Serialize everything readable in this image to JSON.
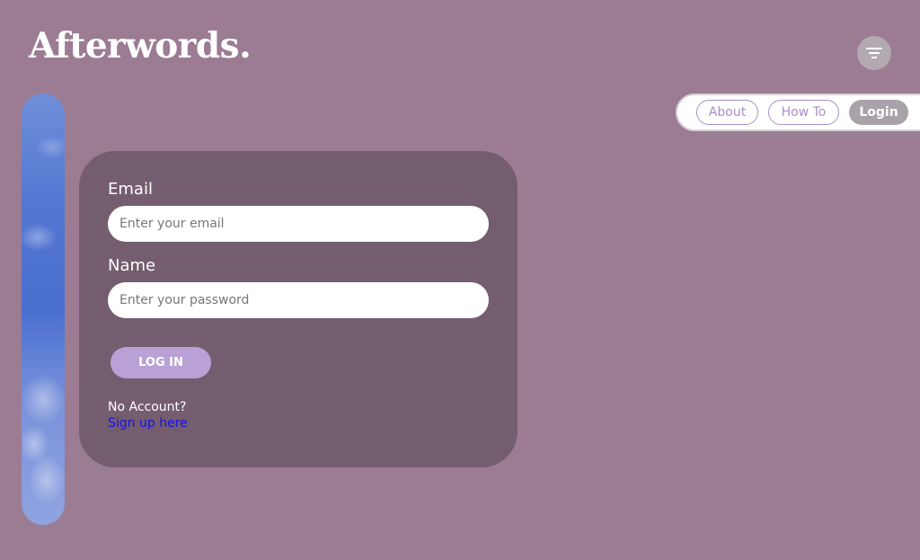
{
  "header": {
    "logo_text": "Afterwords.",
    "menu_icon": "filter-lines-icon"
  },
  "nav": {
    "about_label": "About",
    "howto_label": "How To",
    "login_label": "Login",
    "active": "Login"
  },
  "form": {
    "email_label": "Email",
    "email_placeholder": "Enter your email",
    "email_value": "",
    "name_label": "Name",
    "name_placeholder": "Enter your password",
    "name_value": "",
    "submit_label": "LOG IN",
    "no_account_text": "No Account?",
    "signup_link_text": "Sign up here"
  },
  "colors": {
    "background": "#9b7c93",
    "card": "#745d6e",
    "accent": "#b9a1d6",
    "nav_outline": "#a98fc9",
    "link": "#1a10ee"
  }
}
